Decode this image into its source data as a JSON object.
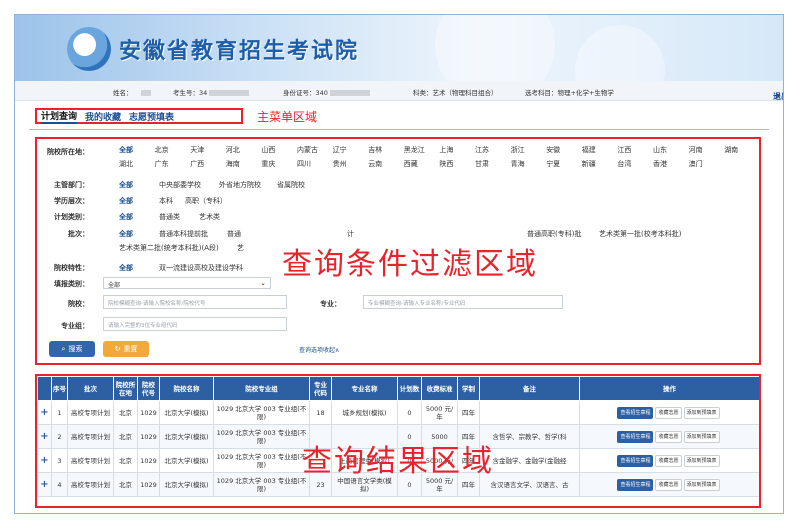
{
  "header": {
    "site_title": "安徽省教育招生考试院"
  },
  "userbar": {
    "name_label": "姓名：",
    "exam_no_label": "考生号：34",
    "id_label": "身份证号：340",
    "subject_type": "科类：艺术（物理科目组合）",
    "elective": "选考科目：物理+化学+生物学",
    "logout": "退出"
  },
  "menu": {
    "items": [
      {
        "label": "计划查询"
      },
      {
        "label": "我的收藏"
      },
      {
        "label": "志愿预填表"
      }
    ]
  },
  "annotations": {
    "menu": "主菜单区域",
    "filter": "查询条件过滤区域",
    "results": "查询结果区域"
  },
  "filters": {
    "location": {
      "label": "院校所在地：",
      "row1": [
        "全部",
        "北京",
        "天津",
        "河北",
        "山西",
        "内蒙古",
        "辽宁",
        "吉林",
        "黑龙江",
        "上海",
        "江苏",
        "浙江",
        "安徽",
        "福建",
        "江西",
        "山东",
        "河南",
        "湖南"
      ],
      "row2": [
        "湖北",
        "广东",
        "广西",
        "海南",
        "重庆",
        "四川",
        "贵州",
        "云南",
        "西藏",
        "陕西",
        "甘肃",
        "青海",
        "宁夏",
        "新疆",
        "台湾",
        "香港",
        "澳门"
      ]
    },
    "department": {
      "label": "主管部门：",
      "options": [
        "全部",
        "中央部委学校",
        "外省地方院校",
        "省属院校"
      ]
    },
    "level": {
      "label": "学历层次：",
      "options": [
        "全部",
        "本科",
        "高职（专科）"
      ]
    },
    "plan_type": {
      "label": "计划类别：",
      "options": [
        "全部",
        "普通类",
        "艺术类"
      ]
    },
    "batch": {
      "label": "批次：",
      "row1": [
        "全部",
        "普通本科提前批",
        "普通",
        "计",
        "普通高职(专科)批",
        "艺术类第一批(校考本科批)"
      ],
      "row2": [
        "艺术类第二批(统考本科批)(A段)",
        "艺"
      ]
    },
    "feature": {
      "label": "院校特性：",
      "options": [
        "全部",
        "双一流建设高校及建设学科"
      ]
    },
    "fill_type": {
      "label": "填报类别：",
      "value": "全部"
    },
    "school": {
      "label": "院校：",
      "placeholder": "院校模糊查询-请输入院校名称/院校代号"
    },
    "major": {
      "label": "专业：",
      "placeholder": "专业模糊查询-请输入专业名称/专业代码"
    },
    "major_group": {
      "label": "专业组：",
      "placeholder": "请输入完整的3位专业组代码"
    },
    "search_button": "搜索",
    "reset_button": "重置",
    "collapse_link": "查询选项收起∧"
  },
  "table": {
    "headers": [
      "",
      "序号",
      "批次",
      "院校所在地",
      "院校代号",
      "院校名称",
      "院校专业组",
      "专业代码",
      "专业名称",
      "计划数",
      "收费标准",
      "学制",
      "备注",
      "操作"
    ],
    "rows": [
      [
        "+",
        "1",
        "高校专项计划",
        "北京",
        "1029",
        "北京大学(模拟)",
        "1029 北京大学 003 专业组(不限)",
        "18",
        "城乡规划(模拟)",
        "0",
        "5000 元/年",
        "四年",
        "",
        ""
      ],
      [
        "+",
        "2",
        "高校专项计划",
        "北京",
        "1029",
        "北京大学(模拟)",
        "1029 北京大学 003 专业组(不限)",
        "",
        "",
        "0",
        "5000",
        "四年",
        "含哲学、宗教学、哲学(科",
        ""
      ],
      [
        "+",
        "3",
        "高校专项计划",
        "北京",
        "1029",
        "北京大学(模拟)",
        "1029 北京大学 003 专业组(不限)",
        "",
        "上商管理类(模拟)",
        "0",
        "5000 元/",
        "四年",
        "含金融学、金融学(金融经",
        ""
      ],
      [
        "+",
        "4",
        "高校专项计划",
        "北京",
        "1029",
        "北京大学(模拟)",
        "1029 北京大学 003 专业组(不限)",
        "23",
        "中国语言文学类(模拟)",
        "0",
        "5000 元/年",
        "四年",
        "含汉语言文学、汉语言、古",
        ""
      ]
    ],
    "ops": [
      "查看招生章程",
      "收藏志愿",
      "添加到预填表"
    ]
  }
}
